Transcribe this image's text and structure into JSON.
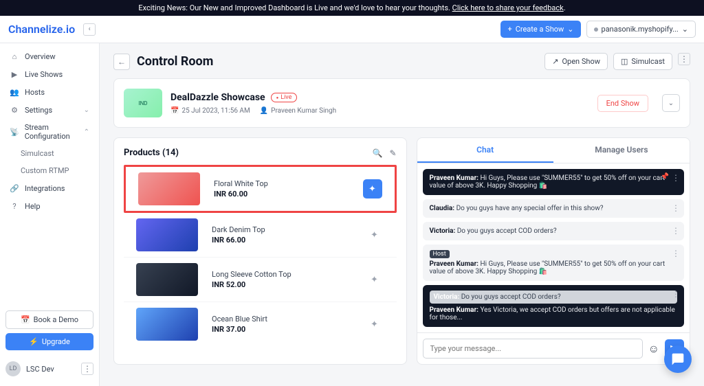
{
  "banner": {
    "text": "Exciting News: Our New and Improved Dashboard is Live and we'd love to hear your thoughts. ",
    "link": "Click here to share your feedback"
  },
  "brand": "Channelize.io",
  "topbar": {
    "create": "Create a Show",
    "store": "panasonik.myshopify..."
  },
  "sidebar": {
    "items": [
      {
        "label": "Overview"
      },
      {
        "label": "Live Shows"
      },
      {
        "label": "Hosts"
      },
      {
        "label": "Settings"
      },
      {
        "label": "Stream Configuration"
      },
      {
        "label": "Simulcast"
      },
      {
        "label": "Custom RTMP"
      },
      {
        "label": "Integrations"
      },
      {
        "label": "Help"
      }
    ],
    "book": "Book a Demo",
    "upgrade": "Upgrade",
    "user": "LSC Dev",
    "user_initials": "LD"
  },
  "header": {
    "title": "Control Room",
    "open": "Open Show",
    "simulcast": "Simulcast"
  },
  "show": {
    "title": "DealDazzle Showcase",
    "live": "Live",
    "date": "25 Jul 2023, 11:56 AM",
    "host": "Praveen Kumar Singh",
    "end": "End Show"
  },
  "products": {
    "title": "Products (14)",
    "list": [
      {
        "name": "Floral White Top",
        "price": "INR 60.00"
      },
      {
        "name": "Dark Denim Top",
        "price": "INR 66.00"
      },
      {
        "name": "Long Sleeve Cotton Top",
        "price": "INR 52.00"
      },
      {
        "name": "Ocean Blue Shirt",
        "price": "INR 37.00"
      }
    ]
  },
  "chat": {
    "tab_chat": "Chat",
    "tab_users": "Manage Users",
    "placeholder": "Type your message...",
    "messages": [
      {
        "author": "Praveen Kumar:",
        "text": " Hi Guys, Please use \"SUMMER55\" to get 50% off on your cart value of above 3K. Happy Shopping 🛍️"
      },
      {
        "author": "Claudia:",
        "text": " Do you guys have any special offer in this show?"
      },
      {
        "author": "Victoria:",
        "text": " Do you guys accept COD orders?"
      },
      {
        "host": "Host",
        "author": "Praveen Kumar:",
        "text": " Hi Guys, Please use \"SUMMER55\" to get 50% off on your cart value of above 3K. Happy Shopping 🛍️"
      },
      {
        "quote_author": "Victoria:",
        "quote_text": " Do you guys accept COD orders?",
        "author": "Praveen Kumar:",
        "text": " Yes Victoria, we accept COD orders but offers are not applicable for those..."
      }
    ]
  }
}
